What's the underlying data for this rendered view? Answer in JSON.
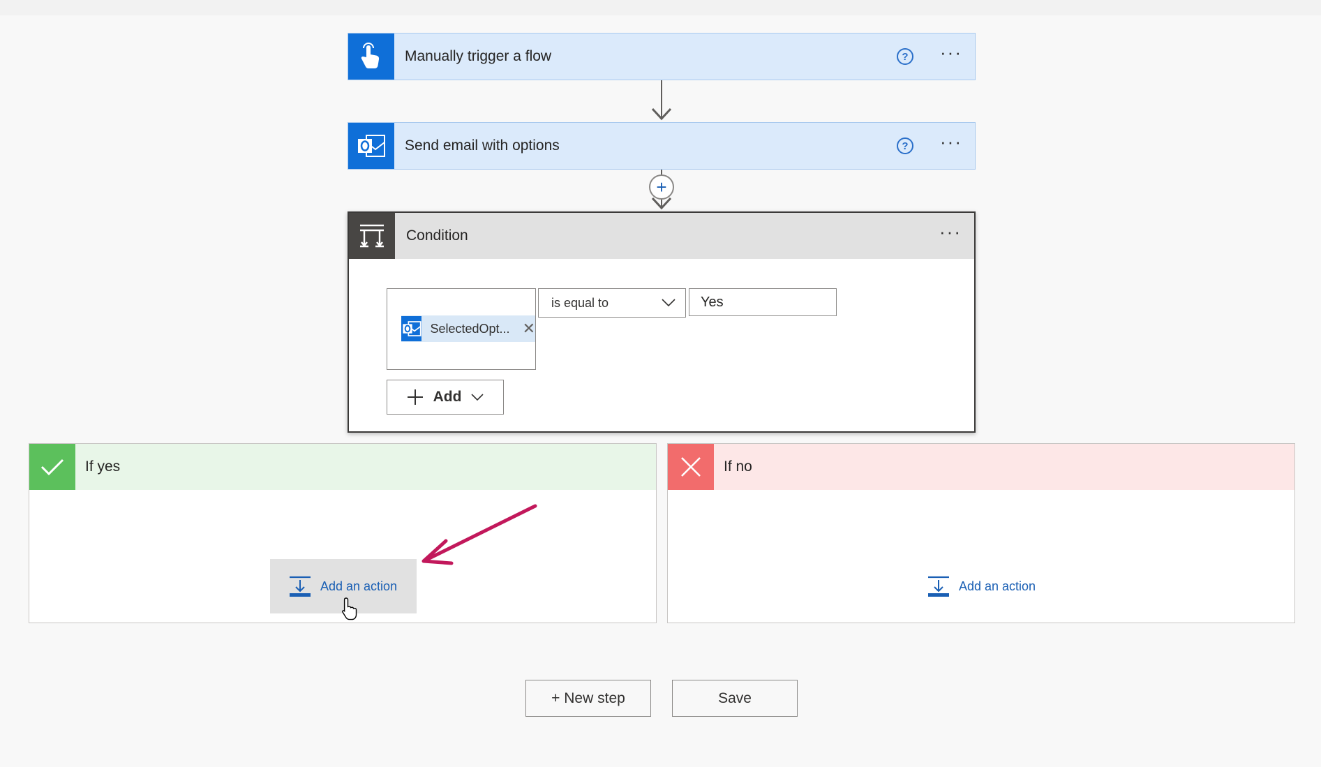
{
  "steps": [
    {
      "title": "Manually trigger a flow",
      "icon": "touch-hand-icon",
      "help": "?",
      "more": "···"
    },
    {
      "title": "Send email with options",
      "icon": "outlook-icon",
      "help": "?",
      "more": "···"
    }
  ],
  "condition": {
    "title": "Condition",
    "more": "···",
    "left_token": "SelectedOpt...",
    "remove_glyph": "✕",
    "operator": "is equal to",
    "value": "Yes",
    "add_button": "Add"
  },
  "branches": {
    "yes": {
      "label": "If yes",
      "add_action": "Add an action",
      "color": "#5cc05c"
    },
    "no": {
      "label": "If no",
      "add_action": "Add an action",
      "color": "#f26c6c"
    }
  },
  "footer": {
    "new_step": "+ New step",
    "save": "Save"
  },
  "colors": {
    "accent": "#0f6fd8",
    "arrow": "#c2185b"
  }
}
